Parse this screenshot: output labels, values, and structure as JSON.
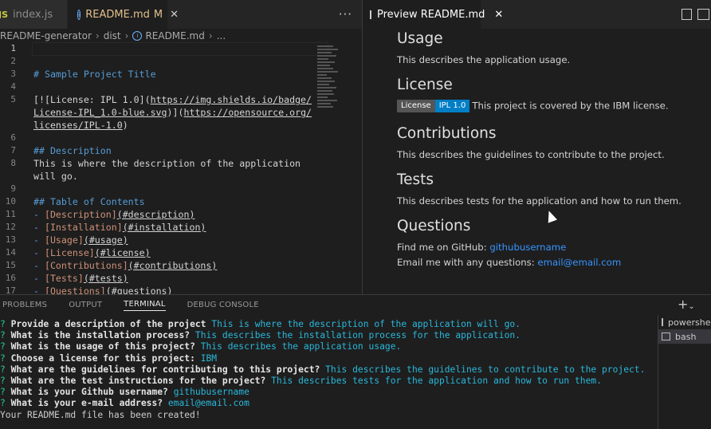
{
  "editor": {
    "tabs": [
      {
        "label": "index.js",
        "icon": "JS"
      },
      {
        "label": "README.md",
        "status": "M"
      }
    ],
    "more": "···",
    "breadcrumb": [
      "README-generator",
      "dist",
      "README.md",
      "..."
    ],
    "lines": [
      {
        "n": "1",
        "text": ""
      },
      {
        "n": "2",
        "text": ""
      },
      {
        "n": "3",
        "text": "# Sample Project Title"
      },
      {
        "n": "4",
        "text": ""
      },
      {
        "n": "5",
        "l1a": "[![License: IPL 1.0](",
        "l1b": "https://img.shields.io/badge/",
        "l2": "License-IPL_1.0-blue.svg",
        "l2b": ")](",
        "l2c": "https://opensource.org/",
        "l3": "licenses/IPL-1.0",
        "l3b": ")"
      },
      {
        "n": "7",
        "text": "## Description"
      },
      {
        "n": "8",
        "text": "This is where the description of the application",
        "cont": "will go."
      },
      {
        "n": "10",
        "text": "## Table of Contents"
      },
      {
        "n": "11",
        "label": "[Description]",
        "link": "(#description)"
      },
      {
        "n": "12",
        "label": "[Installation]",
        "link": "(#installation)"
      },
      {
        "n": "13",
        "label": "[Usage]",
        "link": "(#usage)"
      },
      {
        "n": "14",
        "label": "[License]",
        "link": "(#license)"
      },
      {
        "n": "15",
        "label": "[Contributions]",
        "link": "(#contributions)"
      },
      {
        "n": "16",
        "label": "[Tests]",
        "link": "(#tests)"
      },
      {
        "n": "17",
        "label": "[Questions]",
        "link": "(#questions)"
      }
    ],
    "line_numbers_extra": [
      "6",
      "9"
    ]
  },
  "preview": {
    "tab_label": "Preview README.md",
    "sections": {
      "usage_h": "Usage",
      "usage_p": "This describes the application usage.",
      "license_h": "License",
      "badge_left": "License",
      "badge_right": "IPL 1.0",
      "license_p": "This project is covered by the IBM license.",
      "contrib_h": "Contributions",
      "contrib_p": "This describes the guidelines to contribute to the project.",
      "tests_h": "Tests",
      "tests_p": "This describes tests for the application and how to run them.",
      "questions_h": "Questions",
      "github_prefix": "Find me on GitHub: ",
      "github_link": "githubusername",
      "email_prefix": "Email me with any questions: ",
      "email_link": "email@email.com"
    }
  },
  "panel": {
    "tabs": [
      "PROBLEMS",
      "OUTPUT",
      "TERMINAL",
      "DEBUG CONSOLE"
    ],
    "active_tab": "TERMINAL",
    "add_label": "+",
    "terminals": [
      "powershell",
      "bash"
    ],
    "selected_terminal": "bash",
    "lines": [
      {
        "q": "What are the guidelines for contributing to this project?",
        "a": "This describes the guidelines to contribute to the project."
      }
    ],
    "terminal_lines": [
      {
        "q": "Provide a description of the project",
        "a": "This is where the description of the application will go."
      },
      {
        "q": "What is the installation process?",
        "a": "This describes the installation process for the application."
      },
      {
        "q": "What is the usage of this project?",
        "a": "This describes the application usage."
      },
      {
        "q": "Choose a license for this project:",
        "a": "IBM"
      },
      {
        "q": "What are the guidelines for contributing to this project?",
        "a": "This describes the guidelines to contribute to the project."
      },
      {
        "q": "What are the test instructions for the project?",
        "a": "This describes tests for the application and how to run them."
      },
      {
        "q": "What is your Github username?",
        "a": "githubusername"
      },
      {
        "q": "What is your e-mail address?",
        "a": "email@email.com"
      }
    ],
    "final_line": "Your README.md file has been created!",
    "prompt_mark": "?"
  },
  "colors": {
    "editor_bg": "#1e1e1e",
    "heading": "#569cd6",
    "string": "#ce9178",
    "link": "#3794ff",
    "term_question": "#23d18b",
    "term_answer": "#29b8db"
  }
}
